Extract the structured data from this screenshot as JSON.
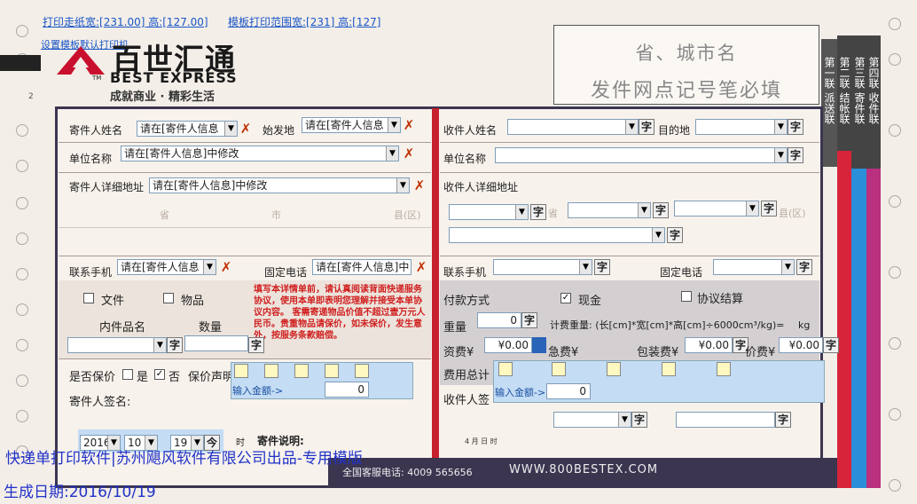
{
  "header": {
    "paper_size": "打印走纸宽:[231.00] 高:[127.00]",
    "print_range": "模板打印范围宽:[231] 高:[127]",
    "set_default": "设置模板默认打印机"
  },
  "logo": {
    "cn": "百世汇通",
    "en": "BEST EXPRESS",
    "slogan": "成就商业 · 精彩生活",
    "tm": "TM",
    "small_mark": "2"
  },
  "banner": {
    "line1": "省、城市名",
    "line2": "发件网点记号笔必填"
  },
  "side_tabs": {
    "t1": "第一联 派送联",
    "t2": "第二联 结帐联",
    "t3": "第三联 寄件联",
    "t4": "第四联 收件联"
  },
  "sender": {
    "name_label": "寄件人姓名",
    "name_value": "请在[寄件人信息",
    "origin_label": "始发地",
    "origin_value": "请在[寄件人信息",
    "company_label": "单位名称",
    "company_value": "请在[寄件人信息]中修改",
    "address_label": "寄件人详细地址",
    "address_value": "请在[寄件人信息]中修改",
    "province": "省",
    "city": "市",
    "county": "县(区)",
    "phone_label": "联系手机",
    "phone_value": "请在[寄件人信息",
    "tel_label": "固定电话",
    "tel_value": "请在[寄件人信息]中"
  },
  "receiver": {
    "name_label": "收件人姓名",
    "dest_label": "目的地",
    "company_label": "单位名称",
    "address_label": "收件人详细地址",
    "province": "省",
    "county": "县(区)",
    "phone_label": "联系手机",
    "tel_label": "固定电话",
    "zi": "字"
  },
  "goods": {
    "doc": "文件",
    "item": "物品",
    "content": "内件品名",
    "qty": "数量",
    "notice": "填写本详情单前，请认真阅读背面快递服务协议，使用本单即表明您理解并接受本单协议内容。 客需寄递物品价值不超过壹万元人民币。贵重物品请保价，如未保价，发生意外，按服务条款赔偿。"
  },
  "insure": {
    "label": "是否保价",
    "yes": "是",
    "no": "否",
    "declare": "保价声明",
    "input_label": "输入金额->",
    "amount": "0"
  },
  "payment": {
    "method": "付款方式",
    "cash": "现金",
    "contract": "协议结算",
    "weight": "重量",
    "weight_value": "0",
    "calc": "计费重量: (长[cm]*宽[cm]*高[cm]÷6000cm³/kg)=",
    "kg": "kg",
    "fee": "资费¥",
    "fee_value": "¥0.00",
    "urgent": "急费¥",
    "pack": "包装费¥",
    "pack_value": "¥0.00",
    "price": "价费¥",
    "price_value": "¥0.00",
    "total": "费用总计",
    "input_label": "输入金额->",
    "amount": "0"
  },
  "sign": {
    "sender": "寄件人签名:",
    "receiver": "收件人签",
    "time": "时",
    "note": "寄件说明:",
    "ymd": "4 月 日 时",
    "year": "2016",
    "month": "10",
    "day": "19",
    "btn": "今"
  },
  "footer": {
    "service": "全国客服电话: 4009 565656",
    "web": "WWW.800BESTEX.COM",
    "maker": "快递单打印软件|苏州飓风软件有限公司出品-专用模版",
    "date": "生成日期:2016/10/19"
  }
}
